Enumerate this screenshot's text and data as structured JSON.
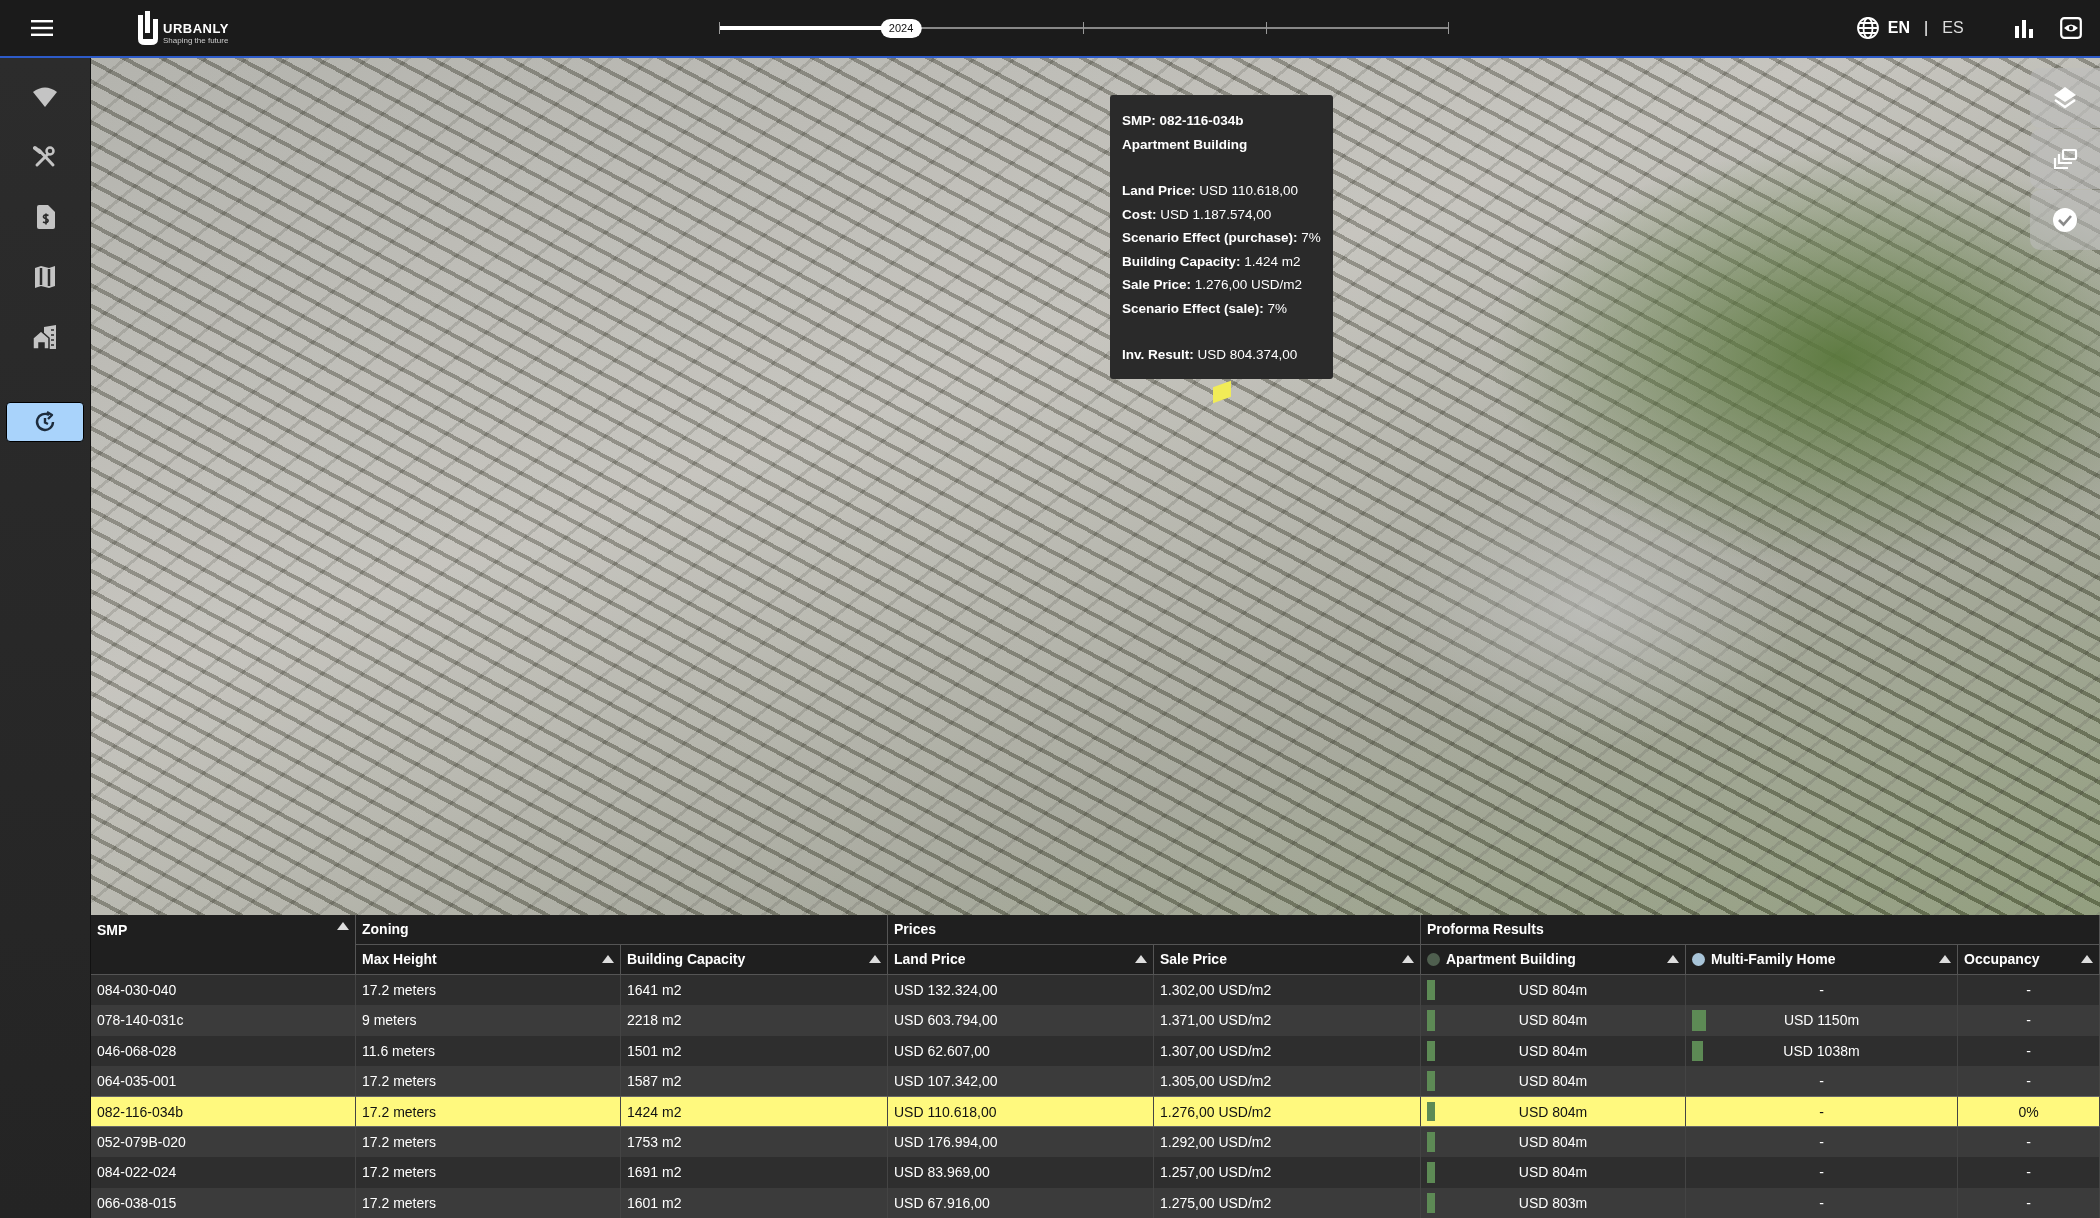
{
  "logo": {
    "name": "URBANLY",
    "tagline": "Shaping the future"
  },
  "timeline": {
    "label": "2024",
    "level": 0.25
  },
  "languages": [
    {
      "label": "EN",
      "selected": true
    },
    {
      "label": "ES",
      "selected": false
    }
  ],
  "language_separator": "|",
  "sidebar": {
    "items": [
      {
        "selected": false
      },
      {
        "selected": false
      },
      {
        "selected": false
      },
      {
        "selected": false
      },
      {
        "selected": false
      },
      {
        "selected": true
      }
    ]
  },
  "tooltip": {
    "title_lines": [
      "SMP: 082-116-034b",
      "Apartment Building"
    ],
    "groups": [
      [
        {
          "label": "Land Price:",
          "value": "USD 110.618,00"
        },
        {
          "label": "Cost:",
          "value": "USD 1.187.574,00"
        },
        {
          "label": "Scenario Effect (purchase):",
          "value": "7%"
        },
        {
          "label": "Building Capacity:",
          "value": "1.424 m2"
        },
        {
          "label": "Sale Price:",
          "value": "1.276,00 USD/m2"
        },
        {
          "label": "Scenario Effect (sale):",
          "value": "7%"
        }
      ],
      [
        {
          "label": "Inv. Result:",
          "value": "USD 804.374,00"
        }
      ]
    ]
  },
  "table": {
    "smp_header": "SMP",
    "groups": [
      {
        "label": "Zoning",
        "columns": [
          {
            "label": "Max Height"
          },
          {
            "label": "Building Capacity"
          }
        ]
      },
      {
        "label": "Prices",
        "columns": [
          {
            "label": "Land Price"
          },
          {
            "label": "Sale Price"
          }
        ]
      },
      {
        "label": "Proforma Results",
        "columns": [
          {
            "label": "Apartment Building",
            "color": "#4f5f4f"
          },
          {
            "label": "Multi-Family Home",
            "color": "#a8c4d8"
          },
          {
            "label": "Occupancy"
          }
        ]
      }
    ],
    "rows": [
      {
        "selected": false,
        "cells": [
          "084-030-040",
          "17.2 meters",
          "1641 m2",
          "USD 132.324,00",
          "1.302,00 USD/m2"
        ],
        "results": [
          {
            "value": "USD 804m",
            "level": 0.03
          },
          {
            "value": "-"
          }
        ],
        "occupancy": "-"
      },
      {
        "selected": false,
        "cells": [
          "078-140-031c",
          "9 meters",
          "2218 m2",
          "USD 603.794,00",
          "1.371,00 USD/m2"
        ],
        "results": [
          {
            "value": "USD 804m",
            "level": 0.03
          },
          {
            "value": "USD 1150m",
            "level": 0.05
          }
        ],
        "occupancy": "-"
      },
      {
        "selected": false,
        "cells": [
          "046-068-028",
          "11.6 meters",
          "1501 m2",
          "USD 62.607,00",
          "1.307,00 USD/m2"
        ],
        "results": [
          {
            "value": "USD 804m",
            "level": 0.03
          },
          {
            "value": "USD 1038m",
            "level": 0.04
          }
        ],
        "occupancy": "-"
      },
      {
        "selected": false,
        "cells": [
          "064-035-001",
          "17.2 meters",
          "1587 m2",
          "USD 107.342,00",
          "1.305,00 USD/m2"
        ],
        "results": [
          {
            "value": "USD 804m",
            "level": 0.03
          },
          {
            "value": "-"
          }
        ],
        "occupancy": "-"
      },
      {
        "selected": true,
        "cells": [
          "082-116-034b",
          "17.2 meters",
          "1424 m2",
          "USD 110.618,00",
          "1.276,00 USD/m2"
        ],
        "results": [
          {
            "value": "USD 804m",
            "level": 0.03
          },
          {
            "value": "-"
          }
        ],
        "occupancy": "0%"
      },
      {
        "selected": false,
        "cells": [
          "052-079B-020",
          "17.2 meters",
          "1753 m2",
          "USD 176.994,00",
          "1.292,00 USD/m2"
        ],
        "results": [
          {
            "value": "USD 804m",
            "level": 0.03
          },
          {
            "value": "-"
          }
        ],
        "occupancy": "-"
      },
      {
        "selected": false,
        "cells": [
          "084-022-024",
          "17.2 meters",
          "1691 m2",
          "USD 83.969,00",
          "1.257,00 USD/m2"
        ],
        "results": [
          {
            "value": "USD 804m",
            "level": 0.03
          },
          {
            "value": "-"
          }
        ],
        "occupancy": "-"
      },
      {
        "selected": false,
        "cells": [
          "066-038-015",
          "17.2 meters",
          "1601 m2",
          "USD 67.916,00",
          "1.275,00 USD/m2"
        ],
        "results": [
          {
            "value": "USD 803m",
            "level": 0.03
          },
          {
            "value": "-"
          }
        ],
        "occupancy": "-"
      }
    ]
  }
}
